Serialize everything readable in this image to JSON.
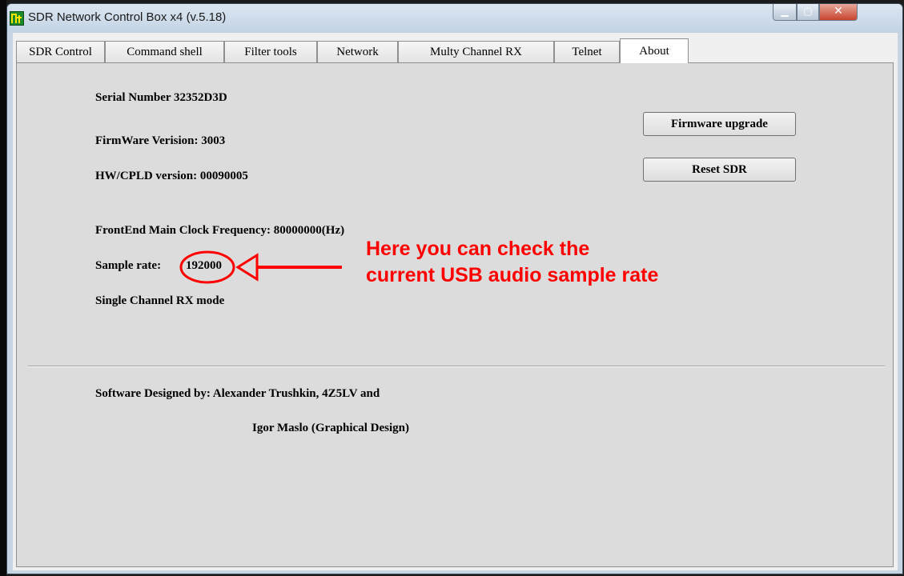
{
  "window": {
    "title": "SDR Network Control Box x4 (v.5.18)"
  },
  "tabs": [
    {
      "label": "SDR Control"
    },
    {
      "label": "Command shell"
    },
    {
      "label": "Filter tools"
    },
    {
      "label": "Network"
    },
    {
      "label": "Multy Channel RX"
    },
    {
      "label": "Telnet"
    },
    {
      "label": "About",
      "active": true
    }
  ],
  "about": {
    "serial_number": "Serial Number  32352D3D",
    "firmware_version": "FirmWare Verision: 3003",
    "hw_version": "HW/CPLD version: 00090005",
    "clock_frequency": "FrontEnd Main Clock Frequency:  80000000(Hz)",
    "sample_rate_label": "Sample rate:",
    "sample_rate_value": "192000",
    "rx_mode": "Single Channel RX mode",
    "designed_by": "Software Designed by:  Alexander Trushkin, 4Z5LV and",
    "graphical_design": "Igor Maslo (Graphical Design)"
  },
  "buttons": {
    "firmware_upgrade": "Firmware upgrade",
    "reset_sdr": "Reset SDR"
  },
  "annotation": {
    "line1": "Here you can check the",
    "line2": "current USB audio sample rate",
    "color": "#ff0000"
  }
}
